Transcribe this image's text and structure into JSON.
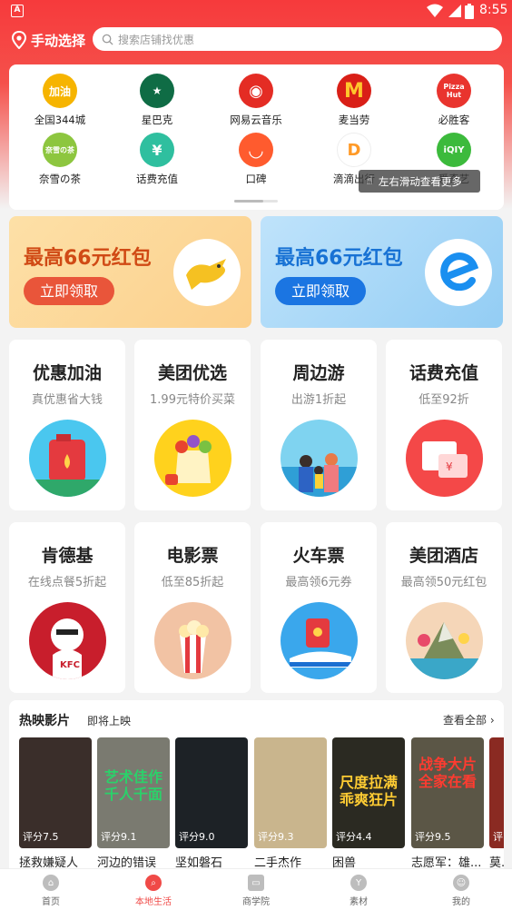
{
  "status_bar": {
    "time": "8:55"
  },
  "header": {
    "location_label": "手动选择",
    "search_placeholder": "搜索店铺找优惠"
  },
  "brands": [
    {
      "name": "全国344城",
      "logo_text": "加油",
      "color": "#f6b400"
    },
    {
      "name": "星巴克",
      "logo_text": "★",
      "color": "#0f6c45"
    },
    {
      "name": "网易云音乐",
      "logo_text": "◉",
      "color": "#e42c24"
    },
    {
      "name": "麦当劳",
      "logo_text": "M",
      "color": "#d91f17"
    },
    {
      "name": "必胜客",
      "logo_text": "Pizza Hut",
      "color": "#e9342e"
    },
    {
      "name": "奈雪の茶",
      "logo_text": "奈雪の茶",
      "color": "#8dc63f"
    },
    {
      "name": "话费充值",
      "logo_text": "¥",
      "color": "#2fbf9f"
    },
    {
      "name": "口碑",
      "logo_text": "◡",
      "color": "#ff5b2e"
    },
    {
      "name": "滴滴出行",
      "logo_text": "D",
      "color": "#ff9a27"
    },
    {
      "name": "爱奇艺",
      "logo_text": "iQIY",
      "color": "#3cba3c"
    }
  ],
  "scroll_tip": "左右滑动查看更多",
  "packets": [
    {
      "title": "最高66元红包",
      "button": "立即领取"
    },
    {
      "title": "最高66元红包",
      "button": "立即领取"
    }
  ],
  "tiles": [
    {
      "title": "优惠加油",
      "sub": "真优惠省大钱"
    },
    {
      "title": "美团优选",
      "sub": "1.99元特价买菜"
    },
    {
      "title": "周边游",
      "sub": "出游1折起"
    },
    {
      "title": "话费充值",
      "sub": "低至92折"
    },
    {
      "title": "肯德基",
      "sub": "在线点餐5折起"
    },
    {
      "title": "电影票",
      "sub": "低至85折起"
    },
    {
      "title": "火车票",
      "sub": "最高领6元券"
    },
    {
      "title": "美团酒店",
      "sub": "最高领50元红包"
    }
  ],
  "movies": {
    "heading": "热映影片",
    "upcoming": "即将上映",
    "see_all": "查看全部 ›",
    "items": [
      {
        "name": "拯救嫌疑人",
        "rating": "评分7.5",
        "poster_text": "",
        "color": "#3a2e2a"
      },
      {
        "name": "河边的错误",
        "rating": "评分9.1",
        "poster_text": "艺术佳作 千人千面",
        "color": "#7a7a70"
      },
      {
        "name": "坚如磐石",
        "rating": "评分9.0",
        "poster_text": "",
        "color": "#1d2226"
      },
      {
        "name": "二手杰作",
        "rating": "评分9.3",
        "poster_text": "",
        "color": "#c9b58d"
      },
      {
        "name": "困兽",
        "rating": "评分4.4",
        "poster_text": "尺度拉满 乖爽狂片",
        "color": "#2b2a22"
      },
      {
        "name": "志愿军：雄...",
        "rating": "评分9.5",
        "poster_text": "战争大片 全家在看",
        "color": "#5b5646"
      },
      {
        "name": "莫...",
        "rating": "评",
        "poster_text": "",
        "color": "#8a2a22"
      }
    ]
  },
  "bottom_nav": [
    {
      "label": "首页",
      "active": false
    },
    {
      "label": "本地生活",
      "active": true
    },
    {
      "label": "商学院",
      "active": false
    },
    {
      "label": "素材",
      "active": false
    },
    {
      "label": "我的",
      "active": false
    }
  ]
}
